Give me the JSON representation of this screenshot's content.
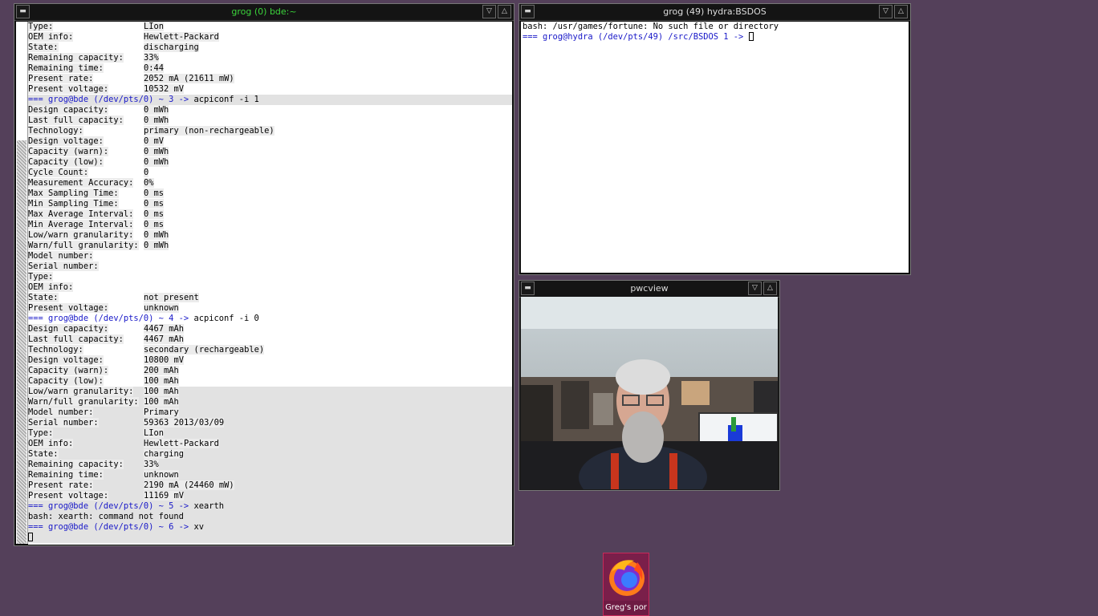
{
  "windows": {
    "left_terminal": {
      "title": "grog (0) bde:~",
      "title_color": "#3bd33b",
      "lines": [
        {
          "k": "Type:",
          "v": "LIon"
        },
        {
          "k": "OEM info:",
          "v": "Hewlett-Packard"
        },
        {
          "k": "State:",
          "v": "discharging"
        },
        {
          "k": "Remaining capacity:",
          "v": "33%"
        },
        {
          "k": "Remaining time:",
          "v": "0:44"
        },
        {
          "k": "Present rate:",
          "v": "2052 mA (21611 mW)"
        },
        {
          "k": "Present voltage:",
          "v": "10532 mV"
        },
        {
          "prompt": "=== grog@bde (/dev/pts/0) ~ 3 ->",
          "cmd": " acpiconf -i 1",
          "hl": true
        },
        {
          "k": "Design capacity:",
          "v": "0 mWh"
        },
        {
          "k": "Last full capacity:",
          "v": "0 mWh"
        },
        {
          "k": "Technology:",
          "v": "primary (non-rechargeable)"
        },
        {
          "k": "Design voltage:",
          "v": "0 mV"
        },
        {
          "k": "Capacity (warn):",
          "v": "0 mWh"
        },
        {
          "k": "Capacity (low):",
          "v": "0 mWh"
        },
        {
          "k": "Cycle Count:",
          "v": "0"
        },
        {
          "k": "Measurement Accuracy:",
          "v": "0%"
        },
        {
          "k": "Max Sampling Time:",
          "v": "0 ms"
        },
        {
          "k": "Min Sampling Time:",
          "v": "0 ms"
        },
        {
          "k": "Max Average Interval:",
          "v": "0 ms"
        },
        {
          "k": "Min Average Interval:",
          "v": "0 ms"
        },
        {
          "k": "Low/warn granularity:",
          "v": "0 mWh"
        },
        {
          "k": "Warn/full granularity:",
          "v": "0 mWh"
        },
        {
          "k": "Model number:",
          "v": ""
        },
        {
          "k": "Serial number:",
          "v": ""
        },
        {
          "k": "Type:",
          "v": ""
        },
        {
          "k": "OEM info:",
          "v": ""
        },
        {
          "k": "State:",
          "v": "not present"
        },
        {
          "k": "Present voltage:",
          "v": "unknown"
        },
        {
          "prompt": "=== grog@bde (/dev/pts/0) ~ 4 ->",
          "cmd": " acpiconf -i 0"
        },
        {
          "k": "Design capacity:",
          "v": "4467 mAh"
        },
        {
          "k": "Last full capacity:",
          "v": "4467 mAh"
        },
        {
          "k": "Technology:",
          "v": "secondary (rechargeable)"
        },
        {
          "k": "Design voltage:",
          "v": "10800 mV"
        },
        {
          "k": "Capacity (warn):",
          "v": "200 mAh"
        },
        {
          "k": "Capacity (low):",
          "v": "100 mAh"
        },
        {
          "k": "Low/warn granularity:",
          "v": "100 mAh",
          "hl": true
        },
        {
          "k": "Warn/full granularity:",
          "v": "100 mAh",
          "hl": true
        },
        {
          "k": "Model number:",
          "v": "Primary",
          "hl": true
        },
        {
          "k": "Serial number:",
          "v": "59363 2013/03/09",
          "hl": true
        },
        {
          "k": "Type:",
          "v": "LIon",
          "hl": true
        },
        {
          "k": "OEM info:",
          "v": "Hewlett-Packard",
          "hl": true
        },
        {
          "k": "State:",
          "v": "charging",
          "hl": true
        },
        {
          "k": "Remaining capacity:",
          "v": "33%",
          "hl": true
        },
        {
          "k": "Remaining time:",
          "v": "unknown",
          "hl": true
        },
        {
          "k": "Present rate:",
          "v": "2190 mA (24460 mW)",
          "hl": true
        },
        {
          "k": "Present voltage:",
          "v": "11169 mV",
          "hl": true
        },
        {
          "prompt": "=== grog@bde (/dev/pts/0) ~ 5 ->",
          "cmd": " xearth",
          "hl": true
        },
        {
          "text": "bash: xearth: command not found",
          "hl": true
        },
        {
          "prompt": "=== grog@bde (/dev/pts/0) ~ 6 ->",
          "cmd": " xv",
          "hl": true
        },
        {
          "cursor": true,
          "hl": true
        }
      ]
    },
    "right_terminal": {
      "title": "grog (49) hydra:BSDOS",
      "title_color": "#dcdcdc",
      "lines": [
        {
          "text": "bash: /usr/games/fortune: No such file or directory"
        },
        {
          "prompt": "=== grog@hydra (/dev/pts/49) /src/BSDOS 1 ->",
          "cmd": " ",
          "cursor": true
        }
      ]
    },
    "pwcview": {
      "title": "pwcview",
      "title_color": "#dcdcdc"
    }
  },
  "titlebar_buttons": {
    "menu": "▬",
    "minimize": "▽",
    "maximize": "△"
  },
  "desktop_icon": {
    "label": "Greg's por",
    "icon": "firefox-icon"
  },
  "colors": {
    "desktop": "#54405a",
    "prompt": "#1818c8",
    "active_title": "#3bd33b"
  }
}
